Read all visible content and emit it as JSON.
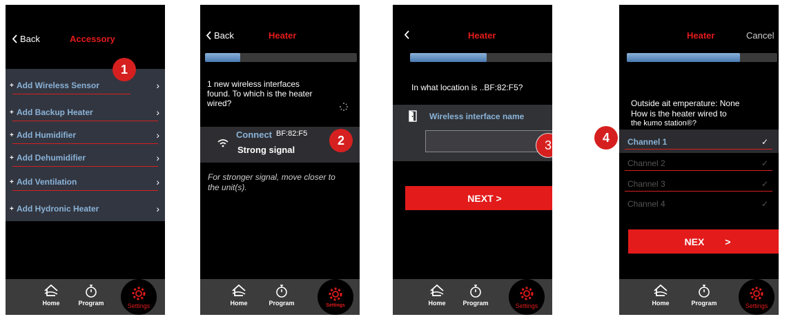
{
  "panel1": {
    "back_label": "Back",
    "title": "Accessory",
    "badge": "1",
    "items": [
      {
        "plus": "+",
        "label": "Add Wireless Sensor"
      },
      {
        "plus": "+",
        "label": "Add Backup Heater"
      },
      {
        "plus": "+",
        "label": "Add Humidifier"
      },
      {
        "plus": "+",
        "label": "Add Dehumidifier"
      },
      {
        "plus": "+",
        "label": "Add Ventilation"
      },
      {
        "plus": "+",
        "label": "Add Hydronic Heater"
      }
    ]
  },
  "panel2": {
    "back_label": "Back",
    "title": "Heater",
    "progress": 0.23,
    "message": "1 new wireless interfaces found. To which is the heater wired?",
    "connect_label": "Connect",
    "device_id": "BF:82:F5",
    "signal_label": "Strong signal",
    "badge": "2",
    "hint": "For stronger signal, move closer to the unit(s)."
  },
  "panel3": {
    "title": "Heater",
    "progress": 0.5,
    "question": "In what location is ..BF:82:F5?",
    "field_label": "Wireless interface name",
    "field_value": "",
    "badge": "3",
    "next_label": "NEXT >"
  },
  "panel4": {
    "title": "Heater",
    "cancel_label": "Cancel",
    "progress": 0.75,
    "message_line1": "Outside ait  emperature: None",
    "message_line2": "How is the heater wired to",
    "message_line3": "the kumo station®?",
    "badge": "4",
    "channels": [
      {
        "label": "Channel 1",
        "check": "✓"
      },
      {
        "label": "Channel 2",
        "check": "✓"
      },
      {
        "label": "Channel 3",
        "check": "✓"
      },
      {
        "label": "Channel 4",
        "check": "✓"
      }
    ],
    "next_label": "NEX",
    "next_chevron": ">"
  },
  "nav": {
    "home": "Home",
    "program": "Program",
    "settings": "Settings"
  },
  "colors": {
    "accent_red": "#e31b1b",
    "link_blue": "#8ab3d8",
    "progress_blue": "#5a88bd"
  }
}
